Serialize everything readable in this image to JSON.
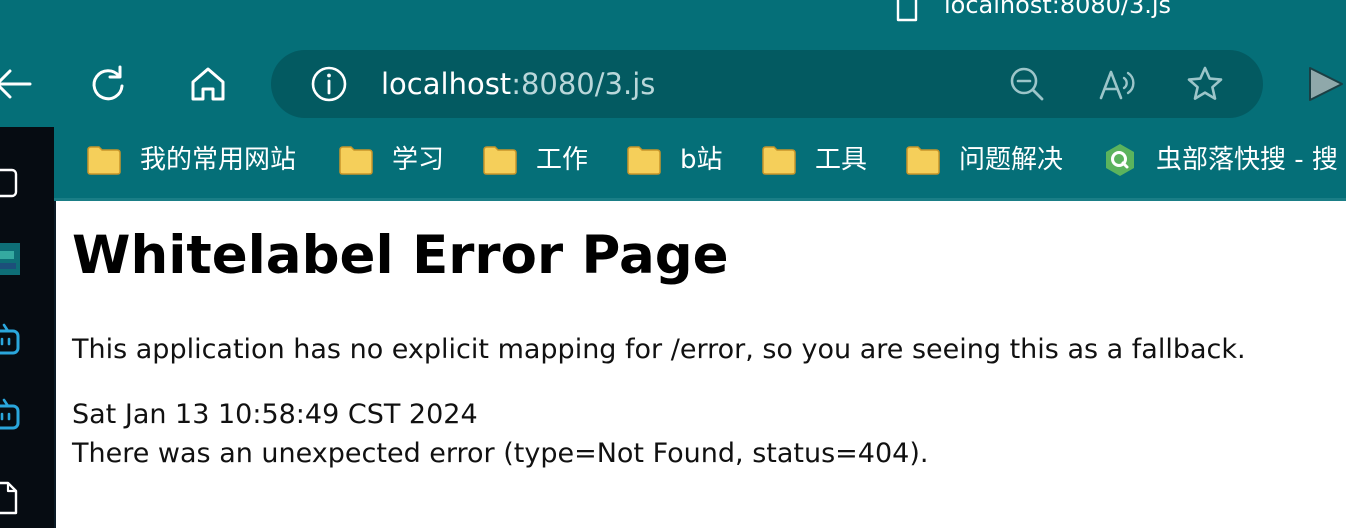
{
  "tab": {
    "title": "localhost:8080/3.js",
    "icon": "page-icon"
  },
  "toolbar": {
    "back_icon": "arrow-left-icon",
    "refresh_icon": "refresh-icon",
    "home_icon": "home-icon"
  },
  "omnibox": {
    "info_icon": "info-icon",
    "url_host": "localhost",
    "url_rest": ":8080/3.js",
    "zoom_icon": "zoom-out-icon",
    "read_aloud_icon": "read-aloud-icon",
    "favorite_icon": "star-icon"
  },
  "bookmarks": [
    {
      "label": "我的常用网站",
      "icon": "folder-icon"
    },
    {
      "label": "学习",
      "icon": "folder-icon"
    },
    {
      "label": "工作",
      "icon": "folder-icon"
    },
    {
      "label": "b站",
      "icon": "folder-icon"
    },
    {
      "label": "工具",
      "icon": "folder-icon"
    },
    {
      "label": "问题解决",
      "icon": "folder-icon"
    },
    {
      "label": "虫部落快搜 - 搜",
      "icon": "q-search-icon"
    }
  ],
  "page": {
    "title": "Whitelabel Error Page",
    "description": "This application has no explicit mapping for /error, so you are seeing this as a fallback.",
    "timestamp": "Sat Jan 13 10:58:49 CST 2024",
    "status_message": "There was an unexpected error (type=Not Found, status=404)."
  },
  "colors": {
    "chrome_bg": "#056f78",
    "omnibox_bg": "#035a61",
    "sidebar_bg": "#060c12",
    "folder_yellow": "#f5cf5a",
    "q_green": "#5bb35d"
  }
}
